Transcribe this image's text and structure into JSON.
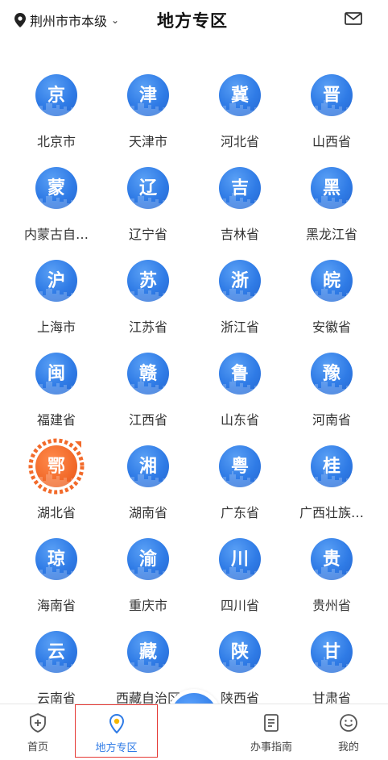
{
  "header": {
    "location": "荆州市市本级",
    "title": "地方专区",
    "location_icon": "location-pin-icon",
    "mail_icon": "mail-icon"
  },
  "regions": [
    {
      "glyph": "京",
      "label": "北京市"
    },
    {
      "glyph": "津",
      "label": "天津市"
    },
    {
      "glyph": "冀",
      "label": "河北省"
    },
    {
      "glyph": "晋",
      "label": "山西省"
    },
    {
      "glyph": "蒙",
      "label": "内蒙古自…"
    },
    {
      "glyph": "辽",
      "label": "辽宁省"
    },
    {
      "glyph": "吉",
      "label": "吉林省"
    },
    {
      "glyph": "黑",
      "label": "黑龙江省"
    },
    {
      "glyph": "沪",
      "label": "上海市"
    },
    {
      "glyph": "苏",
      "label": "江苏省"
    },
    {
      "glyph": "浙",
      "label": "浙江省"
    },
    {
      "glyph": "皖",
      "label": "安徽省"
    },
    {
      "glyph": "闽",
      "label": "福建省"
    },
    {
      "glyph": "赣",
      "label": "江西省"
    },
    {
      "glyph": "鲁",
      "label": "山东省"
    },
    {
      "glyph": "豫",
      "label": "河南省"
    },
    {
      "glyph": "鄂",
      "label": "湖北省",
      "active": true
    },
    {
      "glyph": "湘",
      "label": "湖南省"
    },
    {
      "glyph": "粤",
      "label": "广东省"
    },
    {
      "glyph": "桂",
      "label": "广西壮族…"
    },
    {
      "glyph": "琼",
      "label": "海南省"
    },
    {
      "glyph": "渝",
      "label": "重庆市"
    },
    {
      "glyph": "川",
      "label": "四川省"
    },
    {
      "glyph": "贵",
      "label": "贵州省"
    },
    {
      "glyph": "云",
      "label": "云南省"
    },
    {
      "glyph": "藏",
      "label": "西藏自治区"
    },
    {
      "glyph": "陕",
      "label": "陕西省"
    },
    {
      "glyph": "甘",
      "label": "甘肃省"
    }
  ],
  "tabbar": {
    "home": {
      "label": "首页",
      "icon": "shield-home-icon"
    },
    "local": {
      "label": "地方专区",
      "icon": "location-pin-icon"
    },
    "scan": {
      "icon": "qr-scan-icon"
    },
    "guide": {
      "label": "办事指南",
      "icon": "document-icon"
    },
    "mine": {
      "label": "我的",
      "icon": "smiley-icon"
    }
  },
  "colors": {
    "accent": "#2f7be6",
    "active_region": "#f26a2a",
    "selection_border": "#e53935"
  }
}
